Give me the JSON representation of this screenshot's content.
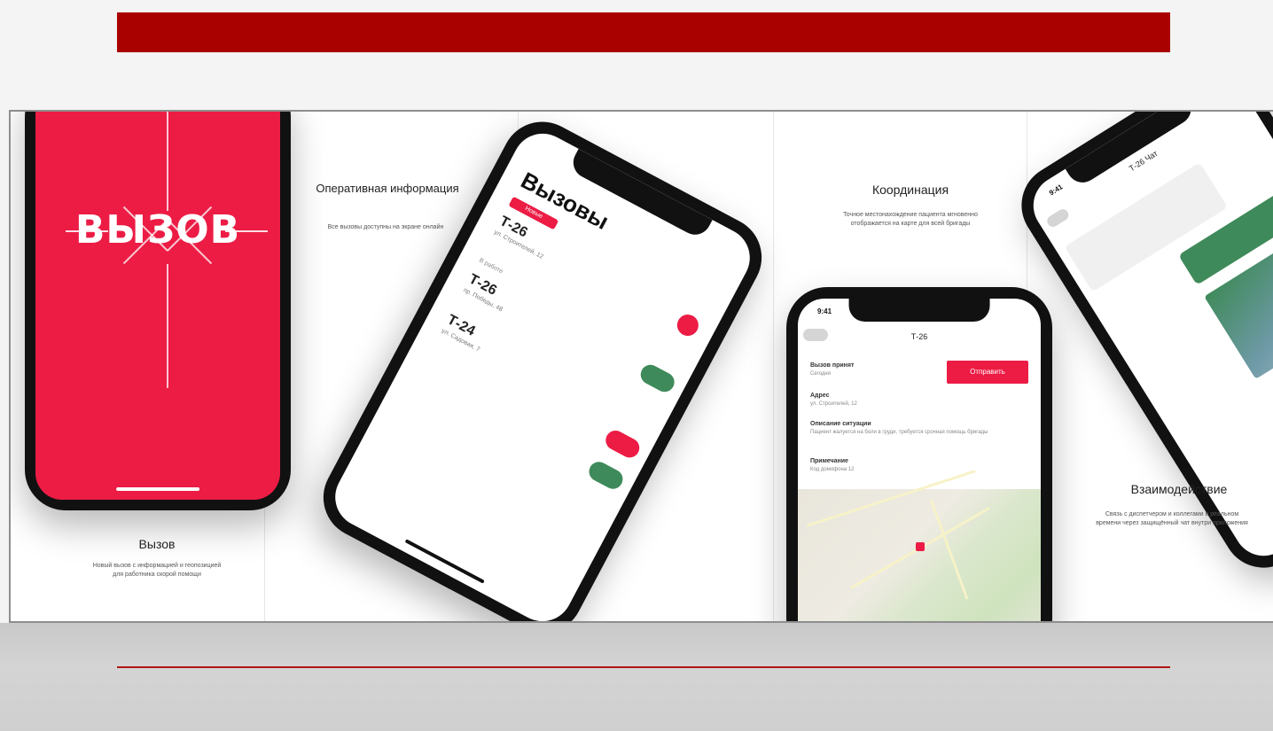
{
  "colors": {
    "top_bar": "#a90000",
    "bottom_line": "#b01515",
    "brand_red": "#ec1c45",
    "green": "#3f8a5a"
  },
  "slides": {
    "splash": {
      "logo": "ВЫЗОВ",
      "caption_title": "Вызов",
      "caption_text": "Новый вызов с информацией и геопозицией для работника скорой помощи"
    },
    "info": {
      "caption_title": "Оперативная информация",
      "caption_text": "Все вызовы доступны на экране онлайн",
      "phone": {
        "title": "Вызовы",
        "badge": "Новые",
        "section_label": "В работе",
        "items": [
          {
            "num": "Т-26",
            "addr": "ул. Строителей, 12"
          },
          {
            "num": "Т-26",
            "addr": "пр. Победы, 48"
          },
          {
            "num": "Т-24",
            "addr": "ул. Садовая, 7"
          }
        ]
      }
    },
    "coord": {
      "caption_title": "Координация",
      "caption_text": "Точное местонахождение пациента мгновенно отображается на карте для всей бригады",
      "phone": {
        "status_time": "9:41",
        "header": "Т-26",
        "button": "Отправить",
        "fields": [
          {
            "label": "Вызов принят",
            "value": "Сегодня"
          },
          {
            "label": "Адрес",
            "value": "ул. Строителей, 12"
          },
          {
            "label": "Описание ситуации",
            "value": "Пациент жалуется на боли в груди, требуется срочная помощь бригады"
          },
          {
            "label": "Примечание",
            "value": "Код домофона 12"
          }
        ],
        "expand_icon": "expand-icon"
      }
    },
    "interact": {
      "caption_title": "Взаимодействие",
      "caption_text": "Связь с диспетчером и коллегами в реальном времени через защищённый чат внутри приложения",
      "phone": {
        "status_time": "9:41",
        "header": "Т-26 Чат"
      }
    }
  }
}
